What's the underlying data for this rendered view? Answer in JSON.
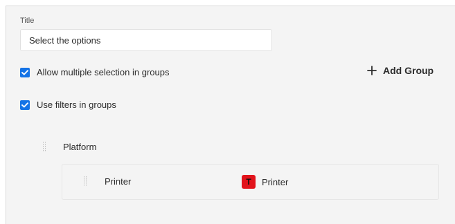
{
  "form": {
    "title_label": "Title",
    "title_value": "Select the options",
    "allow_multiple": {
      "label": "Allow multiple selection in groups",
      "checked": true
    },
    "use_filters": {
      "label": "Use filters in groups",
      "checked": true
    },
    "add_group_label": "Add Group"
  },
  "groups": [
    {
      "name": "Platform",
      "options": [
        {
          "label": "Printer",
          "tag": {
            "badge_letter": "T",
            "badge_color": "#e2141c",
            "label": "Printer"
          }
        }
      ]
    }
  ],
  "colors": {
    "accent": "#1473e6",
    "panel_background": "#f4f4f4"
  },
  "icons": {
    "checkbox": "checkmark-icon",
    "add": "plus-icon",
    "drag": "drag-handle-icon"
  }
}
